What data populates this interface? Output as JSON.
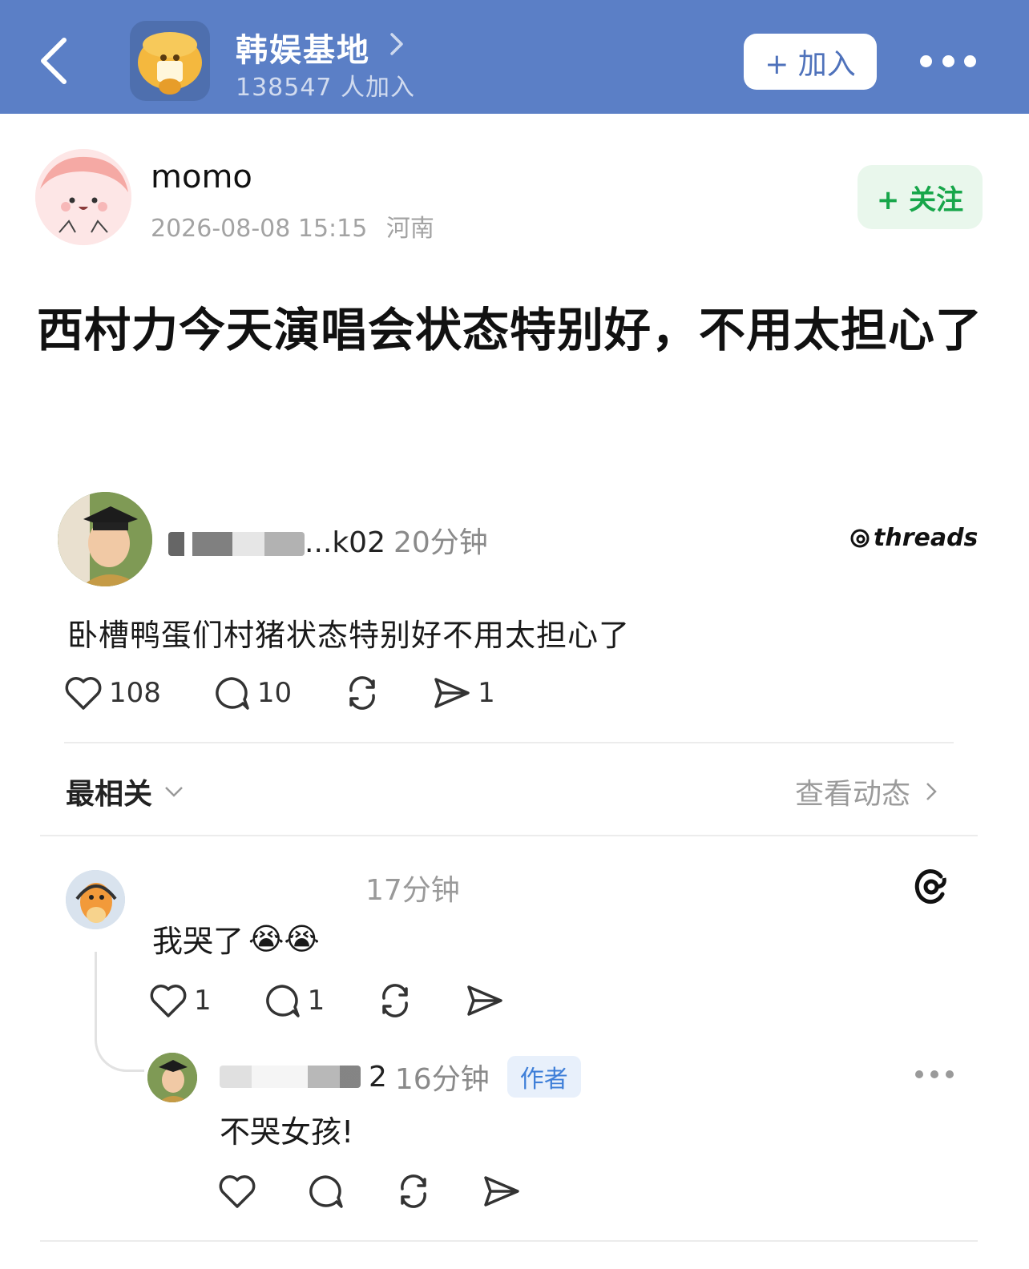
{
  "header": {
    "group_name": "韩娱基地",
    "members": "138547 人加入",
    "join_label": "+ 加入"
  },
  "post": {
    "author": "momo",
    "date": "2026-08-08 15:15",
    "location": "河南",
    "follow_label": "+ 关注",
    "text": "西村力今天演唱会状态特别好，不用太担心了"
  },
  "embed": {
    "username_suffix": "...k02",
    "time": "20分钟",
    "brand": "threads",
    "text": "卧槽鸭蛋们村猪状态特别好不用太担心了",
    "likes": "108",
    "comments": "10",
    "shares": "1",
    "sort_label": "最相关",
    "activity_label": "查看动态",
    "comment": {
      "time": "17分钟",
      "text": "我哭了",
      "emoji": "😭😭",
      "likes": "1",
      "replies": "1"
    },
    "reply": {
      "username_suffix": "2",
      "time": "16分钟",
      "badge": "作者",
      "text": "不哭女孩!"
    }
  },
  "colors": {
    "header_bg": "#5b7fc6",
    "follow_green": "#17a64a",
    "author_badge_blue": "#3f7fd8"
  }
}
